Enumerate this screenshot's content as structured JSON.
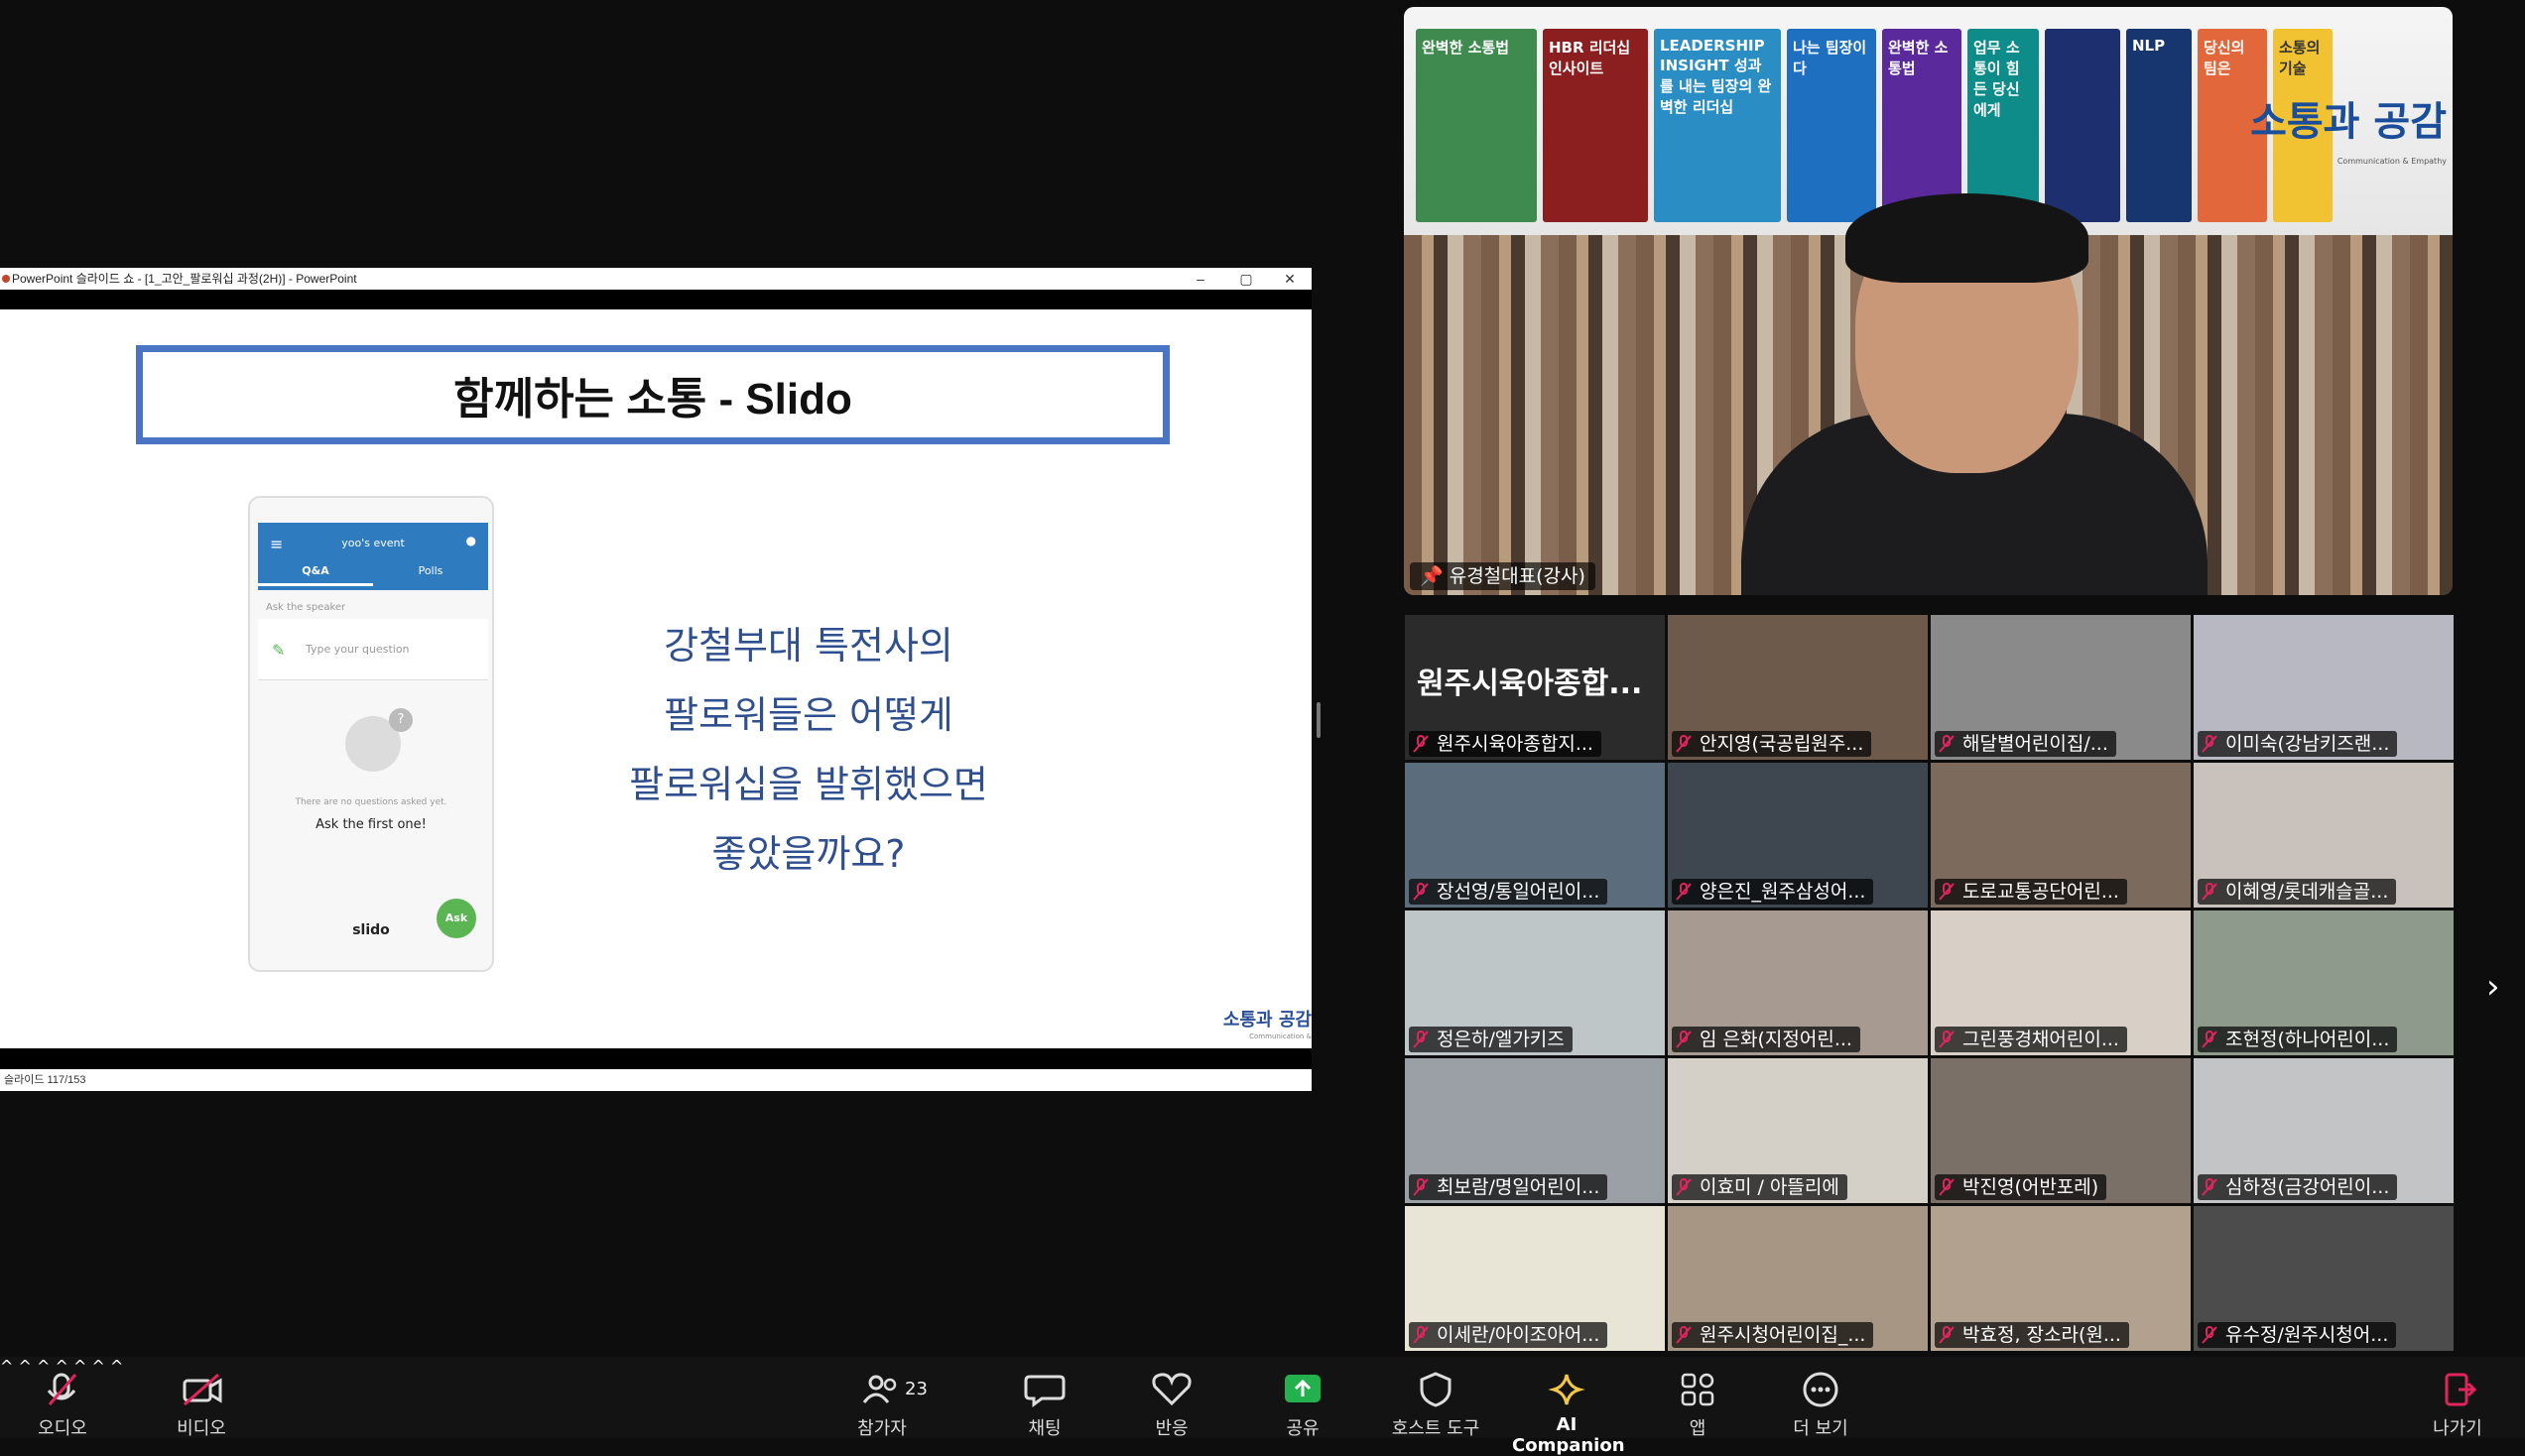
{
  "window": {
    "title": "PowerPoint 슬라이드 쇼 - [1_고안_팔로워십 과정(2H)] - PowerPoint",
    "min": "–",
    "max": "▢",
    "close": "✕"
  },
  "slide": {
    "title": "함께하는 소통 - Slido",
    "question": [
      "강철부대 특전사의",
      "팔로워들은 어떻게",
      "팔로워십을 발휘했으면",
      "좋았을까요?"
    ],
    "logo": "소통과 공감",
    "logo_sub": "Communication & Empathy"
  },
  "phone": {
    "event": "yoo's event",
    "tab_qa": "Q&A",
    "tab_polls": "Polls",
    "ask_label": "Ask the speaker",
    "input_placeholder": "Type your question",
    "empty_text": "There are no questions asked yet.",
    "first_text": "Ask the first one!",
    "brand": "slido",
    "ask_button": "Ask"
  },
  "status": {
    "slide_counter": "슬라이드 117/153"
  },
  "speaker": {
    "name": "유경철대표(강사)",
    "banner_logo": "소통과 공감",
    "banner_logo_sub": "Communication & Empathy",
    "books": [
      "완벽한 소통법",
      "HBR 리더십 인사이트",
      "LEADERSHIP INSIGHT 성과를 내는 팀장의 완벽한 리더십",
      "나는 팀장이다",
      "완벽한 소통법",
      "업무 소통이 힘든 당신에게",
      "",
      "NLP",
      "당신의 팀은",
      "소통의 기술"
    ]
  },
  "gallery_title": "원주시육아종합...",
  "participants": [
    "원주시육아종합지...",
    "안지영(국공립원주...",
    "해달별어린이집/...",
    "이미숙(강남키즈랜...",
    "장선영/통일어린이...",
    "양은진_원주삼성어...",
    "도로교통공단어린...",
    "이혜영/롯데캐슬골...",
    "정은하/엘가키즈",
    "임 은화(지정어린...",
    "그린풍경채어린이...",
    "조현정(하나어린이...",
    "최보람/명일어린이...",
    "이효미 / 아뜰리에",
    "박진영(어반포레)",
    "심하정(금강어린이...",
    "이세란/아이조아어...",
    "원주시청어린이집_...",
    "박효정, 장소라(원...",
    "유수정/원주시청어..."
  ],
  "toolbar": {
    "audio": "오디오",
    "video": "비디오",
    "participants": "참가자",
    "participant_count": "23",
    "chat": "채팅",
    "reactions": "반응",
    "share": "공유",
    "host_tools": "호스트 도구",
    "ai": "AI Companion",
    "apps": "앱",
    "more": "더 보기",
    "leave": "나가기"
  },
  "colors": {
    "slide_accent": "#4a74c4",
    "slido_blue": "#2f7bc0",
    "slido_green": "#5ab552",
    "share_green": "#22b14c",
    "ai_yellow": "#f2c744",
    "muted_red": "#e0245e"
  }
}
